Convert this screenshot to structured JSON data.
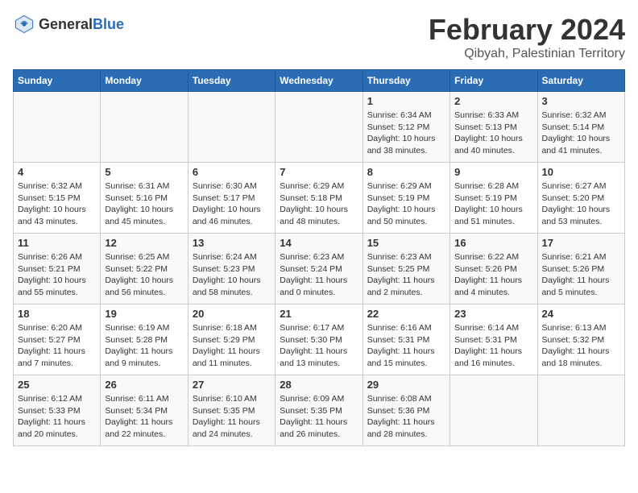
{
  "header": {
    "logo_general": "General",
    "logo_blue": "Blue",
    "month": "February 2024",
    "location": "Qibyah, Palestinian Territory"
  },
  "weekdays": [
    "Sunday",
    "Monday",
    "Tuesday",
    "Wednesday",
    "Thursday",
    "Friday",
    "Saturday"
  ],
  "weeks": [
    [
      {
        "day": "",
        "content": ""
      },
      {
        "day": "",
        "content": ""
      },
      {
        "day": "",
        "content": ""
      },
      {
        "day": "",
        "content": ""
      },
      {
        "day": "1",
        "content": "Sunrise: 6:34 AM\nSunset: 5:12 PM\nDaylight: 10 hours\nand 38 minutes."
      },
      {
        "day": "2",
        "content": "Sunrise: 6:33 AM\nSunset: 5:13 PM\nDaylight: 10 hours\nand 40 minutes."
      },
      {
        "day": "3",
        "content": "Sunrise: 6:32 AM\nSunset: 5:14 PM\nDaylight: 10 hours\nand 41 minutes."
      }
    ],
    [
      {
        "day": "4",
        "content": "Sunrise: 6:32 AM\nSunset: 5:15 PM\nDaylight: 10 hours\nand 43 minutes."
      },
      {
        "day": "5",
        "content": "Sunrise: 6:31 AM\nSunset: 5:16 PM\nDaylight: 10 hours\nand 45 minutes."
      },
      {
        "day": "6",
        "content": "Sunrise: 6:30 AM\nSunset: 5:17 PM\nDaylight: 10 hours\nand 46 minutes."
      },
      {
        "day": "7",
        "content": "Sunrise: 6:29 AM\nSunset: 5:18 PM\nDaylight: 10 hours\nand 48 minutes."
      },
      {
        "day": "8",
        "content": "Sunrise: 6:29 AM\nSunset: 5:19 PM\nDaylight: 10 hours\nand 50 minutes."
      },
      {
        "day": "9",
        "content": "Sunrise: 6:28 AM\nSunset: 5:19 PM\nDaylight: 10 hours\nand 51 minutes."
      },
      {
        "day": "10",
        "content": "Sunrise: 6:27 AM\nSunset: 5:20 PM\nDaylight: 10 hours\nand 53 minutes."
      }
    ],
    [
      {
        "day": "11",
        "content": "Sunrise: 6:26 AM\nSunset: 5:21 PM\nDaylight: 10 hours\nand 55 minutes."
      },
      {
        "day": "12",
        "content": "Sunrise: 6:25 AM\nSunset: 5:22 PM\nDaylight: 10 hours\nand 56 minutes."
      },
      {
        "day": "13",
        "content": "Sunrise: 6:24 AM\nSunset: 5:23 PM\nDaylight: 10 hours\nand 58 minutes."
      },
      {
        "day": "14",
        "content": "Sunrise: 6:23 AM\nSunset: 5:24 PM\nDaylight: 11 hours\nand 0 minutes."
      },
      {
        "day": "15",
        "content": "Sunrise: 6:23 AM\nSunset: 5:25 PM\nDaylight: 11 hours\nand 2 minutes."
      },
      {
        "day": "16",
        "content": "Sunrise: 6:22 AM\nSunset: 5:26 PM\nDaylight: 11 hours\nand 4 minutes."
      },
      {
        "day": "17",
        "content": "Sunrise: 6:21 AM\nSunset: 5:26 PM\nDaylight: 11 hours\nand 5 minutes."
      }
    ],
    [
      {
        "day": "18",
        "content": "Sunrise: 6:20 AM\nSunset: 5:27 PM\nDaylight: 11 hours\nand 7 minutes."
      },
      {
        "day": "19",
        "content": "Sunrise: 6:19 AM\nSunset: 5:28 PM\nDaylight: 11 hours\nand 9 minutes."
      },
      {
        "day": "20",
        "content": "Sunrise: 6:18 AM\nSunset: 5:29 PM\nDaylight: 11 hours\nand 11 minutes."
      },
      {
        "day": "21",
        "content": "Sunrise: 6:17 AM\nSunset: 5:30 PM\nDaylight: 11 hours\nand 13 minutes."
      },
      {
        "day": "22",
        "content": "Sunrise: 6:16 AM\nSunset: 5:31 PM\nDaylight: 11 hours\nand 15 minutes."
      },
      {
        "day": "23",
        "content": "Sunrise: 6:14 AM\nSunset: 5:31 PM\nDaylight: 11 hours\nand 16 minutes."
      },
      {
        "day": "24",
        "content": "Sunrise: 6:13 AM\nSunset: 5:32 PM\nDaylight: 11 hours\nand 18 minutes."
      }
    ],
    [
      {
        "day": "25",
        "content": "Sunrise: 6:12 AM\nSunset: 5:33 PM\nDaylight: 11 hours\nand 20 minutes."
      },
      {
        "day": "26",
        "content": "Sunrise: 6:11 AM\nSunset: 5:34 PM\nDaylight: 11 hours\nand 22 minutes."
      },
      {
        "day": "27",
        "content": "Sunrise: 6:10 AM\nSunset: 5:35 PM\nDaylight: 11 hours\nand 24 minutes."
      },
      {
        "day": "28",
        "content": "Sunrise: 6:09 AM\nSunset: 5:35 PM\nDaylight: 11 hours\nand 26 minutes."
      },
      {
        "day": "29",
        "content": "Sunrise: 6:08 AM\nSunset: 5:36 PM\nDaylight: 11 hours\nand 28 minutes."
      },
      {
        "day": "",
        "content": ""
      },
      {
        "day": "",
        "content": ""
      }
    ]
  ]
}
